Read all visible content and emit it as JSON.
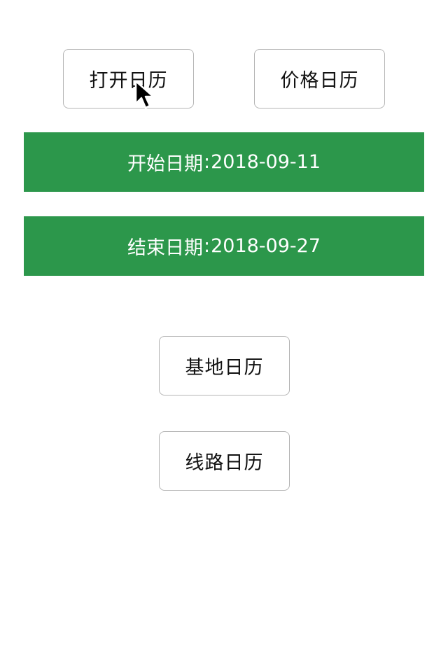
{
  "buttons": {
    "open_calendar": "打开日历",
    "price_calendar": "价格日历",
    "base_calendar": "基地日历",
    "route_calendar": "线路日历"
  },
  "start_date": {
    "label": "开始日期",
    "separator": ":",
    "value": "2018-09-11"
  },
  "end_date": {
    "label": "结束日期",
    "separator": ":",
    "value": "2018-09-27"
  },
  "colors": {
    "date_bar_bg": "#2c974b",
    "date_bar_text": "#ffffff",
    "button_border": "#b5b5b5"
  },
  "icons": {
    "cursor": "mouse-pointer-icon"
  }
}
